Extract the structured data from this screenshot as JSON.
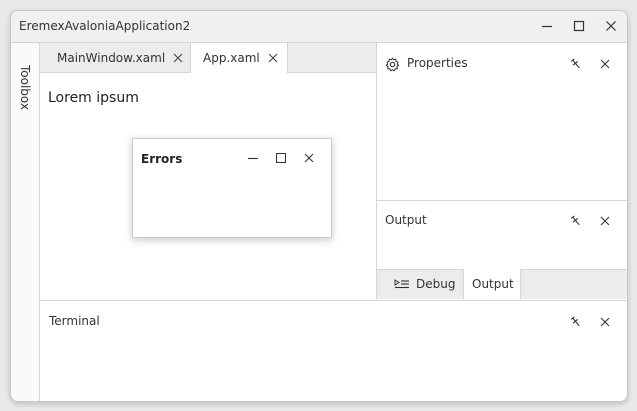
{
  "window": {
    "title": "EremexAvaloniaApplication2"
  },
  "toolbox": {
    "label": "Toolbox"
  },
  "document_tabs": [
    {
      "label": "MainWindow.xaml",
      "active": false
    },
    {
      "label": "App.xaml",
      "active": true
    }
  ],
  "document": {
    "content": "Lorem ipsum"
  },
  "floating_window": {
    "title": "Errors"
  },
  "properties_panel": {
    "title": "Properties"
  },
  "output_panel": {
    "title": "Output"
  },
  "output_tabs": [
    {
      "label": "Debug",
      "active": false
    },
    {
      "label": "Output",
      "active": true
    }
  ],
  "terminal_panel": {
    "title": "Terminal"
  },
  "icons": {
    "minimize": "minimize-icon",
    "maximize": "maximize-icon",
    "close": "close-icon",
    "pin": "pin-icon",
    "gear": "gear-icon",
    "debug": "debug-icon"
  },
  "colors": {
    "titlebar": "#f0f0f0",
    "tabstrip": "#ececec",
    "border": "#d6d6d6",
    "background": "#ffffff"
  }
}
